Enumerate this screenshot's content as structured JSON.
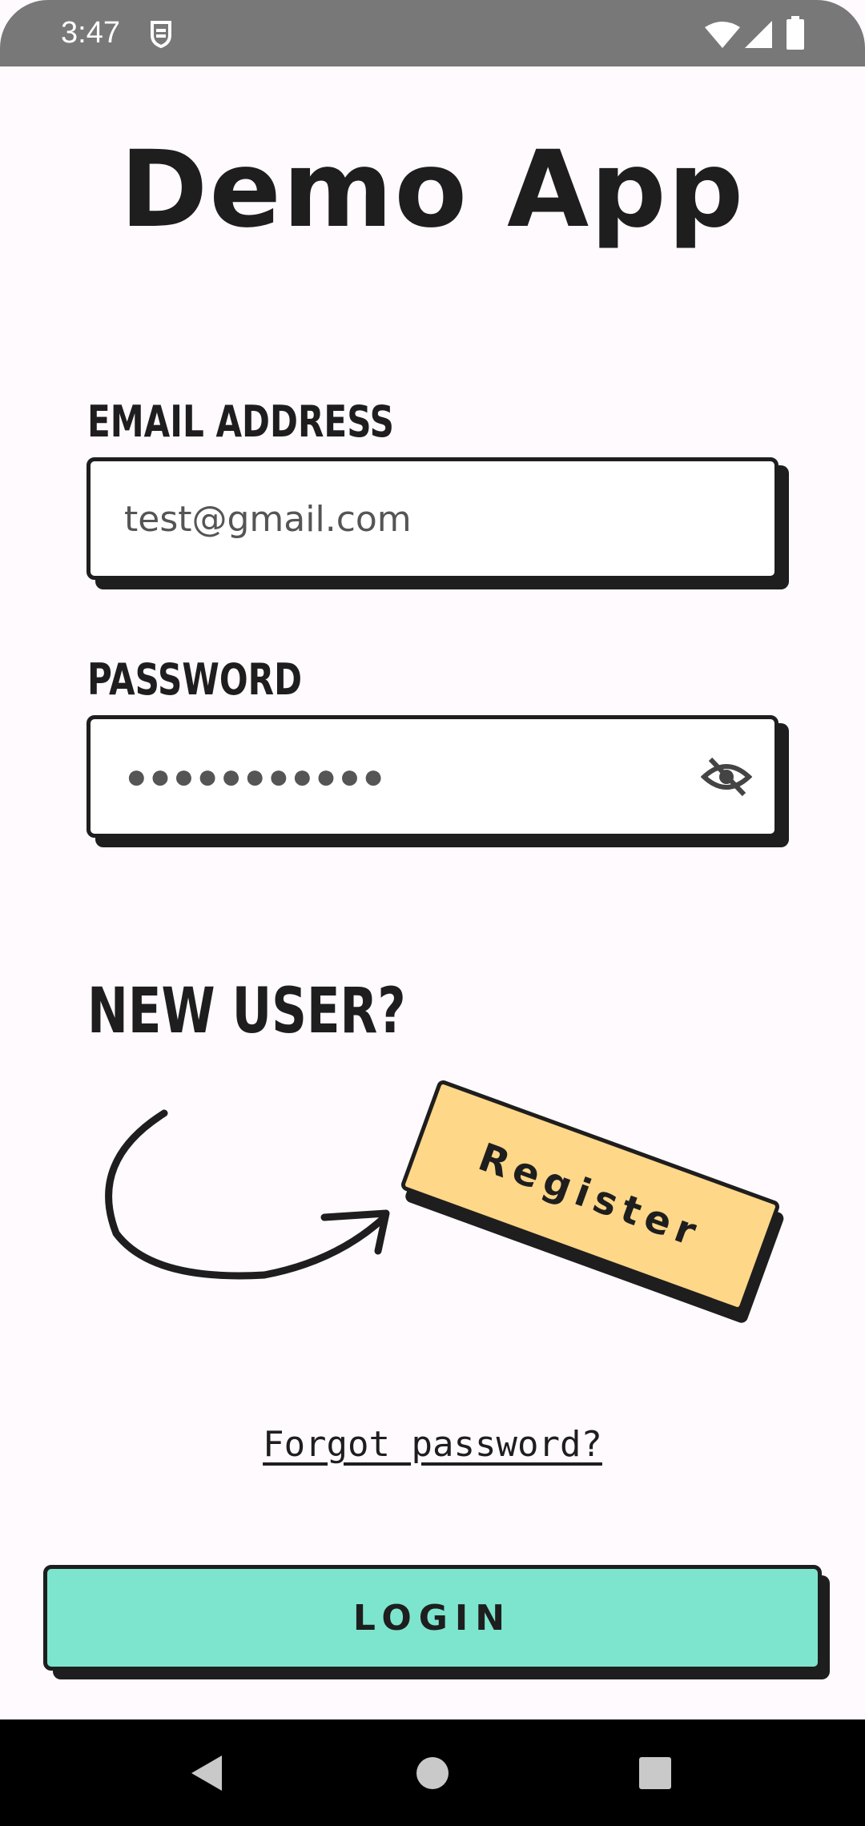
{
  "status_bar": {
    "time": "3:47",
    "icons": [
      "sync-shield-icon",
      "wifi-icon",
      "cellular-icon",
      "battery-icon"
    ]
  },
  "app": {
    "title": "Demo App"
  },
  "login_form": {
    "email_label": "EMAIL ADDRESS",
    "email_value": "test@gmail.com",
    "password_label": "PASSWORD",
    "password_value": "●●●●●●●●●●●",
    "password_toggle_icon": "eye-off-icon"
  },
  "register_section": {
    "prompt": "NEW USER?",
    "register_label": "Register"
  },
  "forgot_password_label": "Forgot password?",
  "login_label": "LOGIN",
  "nav_bar": {
    "buttons": [
      "back-icon",
      "home-icon",
      "recents-icon"
    ]
  },
  "colors": {
    "background": "#fffafd",
    "ink": "#1e1e1e",
    "register_button": "#fed789",
    "login_button": "#7de5cd",
    "status_bar": "#787878"
  }
}
